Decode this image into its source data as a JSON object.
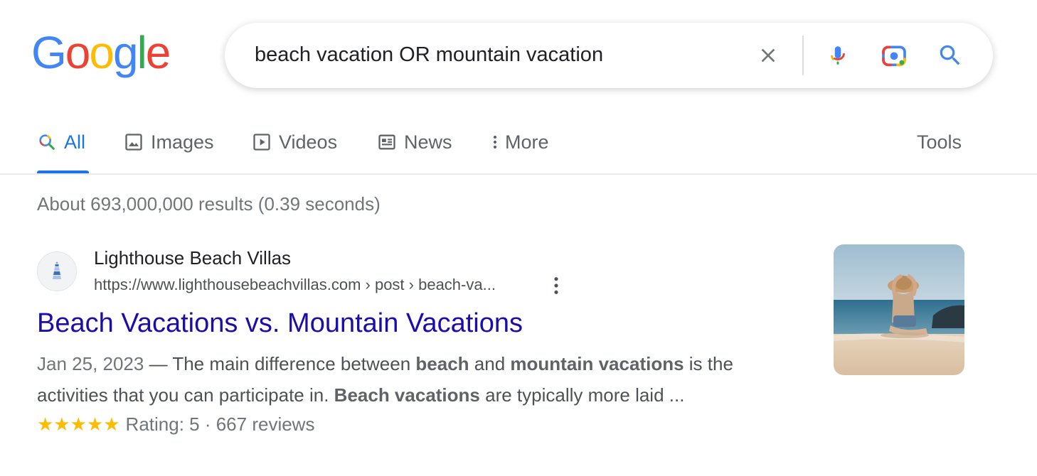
{
  "logo": {
    "letters": [
      "G",
      "o",
      "o",
      "g",
      "l",
      "e"
    ],
    "colors": [
      "#4285f4",
      "#ea4335",
      "#fbbc05",
      "#4285f4",
      "#34a853",
      "#ea4335"
    ]
  },
  "search": {
    "query": "beach vacation OR mountain vacation"
  },
  "icons": {
    "clear": "close-icon",
    "mic": "microphone-icon",
    "lens": "camera-lens-icon",
    "search": "search-icon"
  },
  "tabs": [
    {
      "label": "All",
      "icon": "search-icon",
      "active": true
    },
    {
      "label": "Images",
      "icon": "image-icon",
      "active": false
    },
    {
      "label": "Videos",
      "icon": "play-icon",
      "active": false
    },
    {
      "label": "News",
      "icon": "news-icon",
      "active": false
    },
    {
      "label": "More",
      "icon": "more-vert-icon",
      "active": false
    }
  ],
  "tools_label": "Tools",
  "result_stats": "About 693,000,000 results (0.39 seconds)",
  "result": {
    "site_name": "Lighthouse Beach Villas",
    "url": "https://www.lighthousebeachvillas.com › post › beach-va...",
    "title": "Beach Vacations vs. Mountain Vacations",
    "snippet": {
      "date": "Jan 25, 2023",
      "separator": " — ",
      "parts": [
        {
          "text": "The main difference between ",
          "bold": false
        },
        {
          "text": "beach",
          "bold": true
        },
        {
          "text": " and ",
          "bold": false
        },
        {
          "text": "mountain vacations",
          "bold": true
        },
        {
          "text": " is the activities that you can participate in. ",
          "bold": false
        },
        {
          "text": "Beach vacations",
          "bold": true
        },
        {
          "text": " are typically more laid ...",
          "bold": false
        }
      ]
    },
    "rating": {
      "stars_text": "★★★★★",
      "stars": 5,
      "text": "Rating: 5 · 667 reviews"
    }
  },
  "colors": {
    "accent": "#1a73e8",
    "link": "#1a0dab",
    "star": "#fbbc04"
  }
}
